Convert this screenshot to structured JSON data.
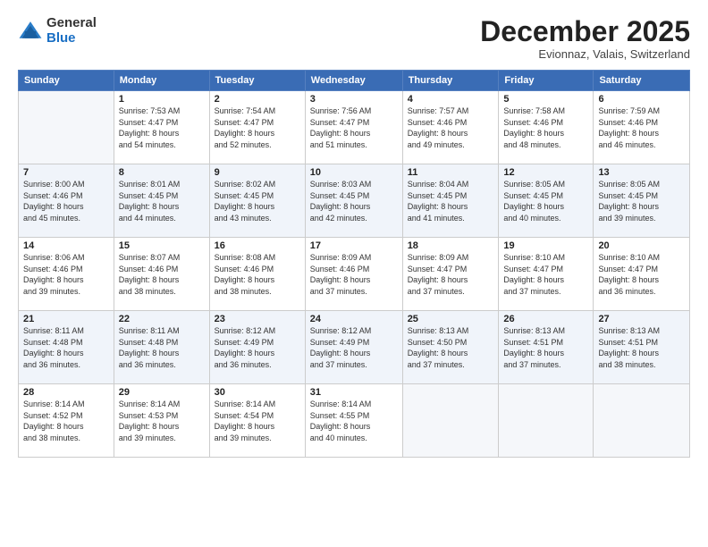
{
  "header": {
    "logo_general": "General",
    "logo_blue": "Blue",
    "month_title": "December 2025",
    "subtitle": "Evionnaz, Valais, Switzerland"
  },
  "days_of_week": [
    "Sunday",
    "Monday",
    "Tuesday",
    "Wednesday",
    "Thursday",
    "Friday",
    "Saturday"
  ],
  "weeks": [
    [
      {
        "day": "",
        "info": ""
      },
      {
        "day": "1",
        "info": "Sunrise: 7:53 AM\nSunset: 4:47 PM\nDaylight: 8 hours\nand 54 minutes."
      },
      {
        "day": "2",
        "info": "Sunrise: 7:54 AM\nSunset: 4:47 PM\nDaylight: 8 hours\nand 52 minutes."
      },
      {
        "day": "3",
        "info": "Sunrise: 7:56 AM\nSunset: 4:47 PM\nDaylight: 8 hours\nand 51 minutes."
      },
      {
        "day": "4",
        "info": "Sunrise: 7:57 AM\nSunset: 4:46 PM\nDaylight: 8 hours\nand 49 minutes."
      },
      {
        "day": "5",
        "info": "Sunrise: 7:58 AM\nSunset: 4:46 PM\nDaylight: 8 hours\nand 48 minutes."
      },
      {
        "day": "6",
        "info": "Sunrise: 7:59 AM\nSunset: 4:46 PM\nDaylight: 8 hours\nand 46 minutes."
      }
    ],
    [
      {
        "day": "7",
        "info": "Sunrise: 8:00 AM\nSunset: 4:46 PM\nDaylight: 8 hours\nand 45 minutes."
      },
      {
        "day": "8",
        "info": "Sunrise: 8:01 AM\nSunset: 4:45 PM\nDaylight: 8 hours\nand 44 minutes."
      },
      {
        "day": "9",
        "info": "Sunrise: 8:02 AM\nSunset: 4:45 PM\nDaylight: 8 hours\nand 43 minutes."
      },
      {
        "day": "10",
        "info": "Sunrise: 8:03 AM\nSunset: 4:45 PM\nDaylight: 8 hours\nand 42 minutes."
      },
      {
        "day": "11",
        "info": "Sunrise: 8:04 AM\nSunset: 4:45 PM\nDaylight: 8 hours\nand 41 minutes."
      },
      {
        "day": "12",
        "info": "Sunrise: 8:05 AM\nSunset: 4:45 PM\nDaylight: 8 hours\nand 40 minutes."
      },
      {
        "day": "13",
        "info": "Sunrise: 8:05 AM\nSunset: 4:45 PM\nDaylight: 8 hours\nand 39 minutes."
      }
    ],
    [
      {
        "day": "14",
        "info": "Sunrise: 8:06 AM\nSunset: 4:46 PM\nDaylight: 8 hours\nand 39 minutes."
      },
      {
        "day": "15",
        "info": "Sunrise: 8:07 AM\nSunset: 4:46 PM\nDaylight: 8 hours\nand 38 minutes."
      },
      {
        "day": "16",
        "info": "Sunrise: 8:08 AM\nSunset: 4:46 PM\nDaylight: 8 hours\nand 38 minutes."
      },
      {
        "day": "17",
        "info": "Sunrise: 8:09 AM\nSunset: 4:46 PM\nDaylight: 8 hours\nand 37 minutes."
      },
      {
        "day": "18",
        "info": "Sunrise: 8:09 AM\nSunset: 4:47 PM\nDaylight: 8 hours\nand 37 minutes."
      },
      {
        "day": "19",
        "info": "Sunrise: 8:10 AM\nSunset: 4:47 PM\nDaylight: 8 hours\nand 37 minutes."
      },
      {
        "day": "20",
        "info": "Sunrise: 8:10 AM\nSunset: 4:47 PM\nDaylight: 8 hours\nand 36 minutes."
      }
    ],
    [
      {
        "day": "21",
        "info": "Sunrise: 8:11 AM\nSunset: 4:48 PM\nDaylight: 8 hours\nand 36 minutes."
      },
      {
        "day": "22",
        "info": "Sunrise: 8:11 AM\nSunset: 4:48 PM\nDaylight: 8 hours\nand 36 minutes."
      },
      {
        "day": "23",
        "info": "Sunrise: 8:12 AM\nSunset: 4:49 PM\nDaylight: 8 hours\nand 36 minutes."
      },
      {
        "day": "24",
        "info": "Sunrise: 8:12 AM\nSunset: 4:49 PM\nDaylight: 8 hours\nand 37 minutes."
      },
      {
        "day": "25",
        "info": "Sunrise: 8:13 AM\nSunset: 4:50 PM\nDaylight: 8 hours\nand 37 minutes."
      },
      {
        "day": "26",
        "info": "Sunrise: 8:13 AM\nSunset: 4:51 PM\nDaylight: 8 hours\nand 37 minutes."
      },
      {
        "day": "27",
        "info": "Sunrise: 8:13 AM\nSunset: 4:51 PM\nDaylight: 8 hours\nand 38 minutes."
      }
    ],
    [
      {
        "day": "28",
        "info": "Sunrise: 8:14 AM\nSunset: 4:52 PM\nDaylight: 8 hours\nand 38 minutes."
      },
      {
        "day": "29",
        "info": "Sunrise: 8:14 AM\nSunset: 4:53 PM\nDaylight: 8 hours\nand 39 minutes."
      },
      {
        "day": "30",
        "info": "Sunrise: 8:14 AM\nSunset: 4:54 PM\nDaylight: 8 hours\nand 39 minutes."
      },
      {
        "day": "31",
        "info": "Sunrise: 8:14 AM\nSunset: 4:55 PM\nDaylight: 8 hours\nand 40 minutes."
      },
      {
        "day": "",
        "info": ""
      },
      {
        "day": "",
        "info": ""
      },
      {
        "day": "",
        "info": ""
      }
    ]
  ]
}
